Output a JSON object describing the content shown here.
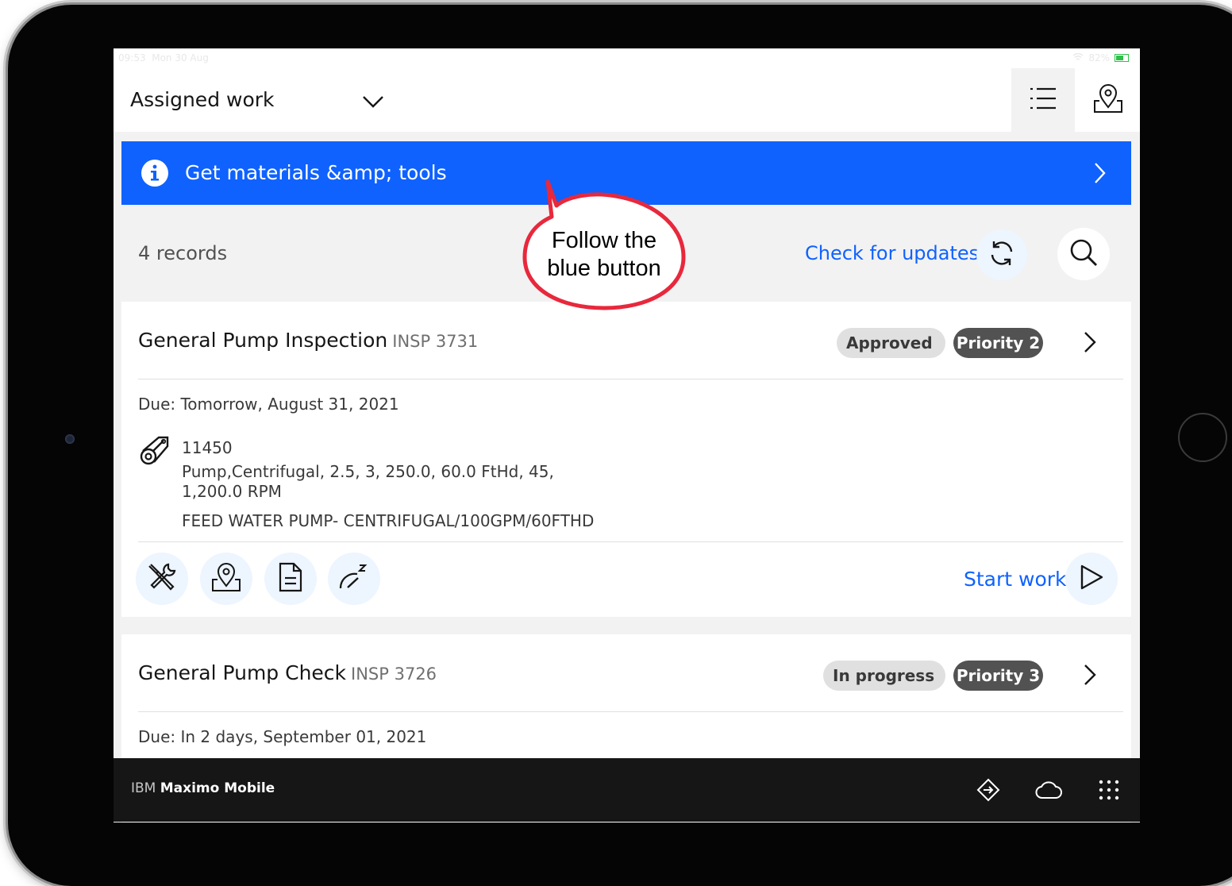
{
  "status_bar": {
    "time": "09:53",
    "date": "Mon 30 Aug",
    "battery": "82%"
  },
  "header": {
    "title": "Assigned work"
  },
  "banner": {
    "label": "Get materials &amp; tools"
  },
  "toolbar": {
    "records": "4 records",
    "check_updates": "Check for updates"
  },
  "work_orders": [
    {
      "title": "General Pump Inspection",
      "code": "INSP 3731",
      "status": "Approved",
      "priority": "Priority 2",
      "due": "Due: Tomorrow, August 31, 2021",
      "asset_number": "11450",
      "asset_description": "Pump,Centrifugal, 2.5, 3, 250.0, 60.0 FtHd, 45, 1,200.0 RPM",
      "asset_location": "FEED WATER PUMP- CENTRIFUGAL/100GPM/60FTHD",
      "start_label": "Start work"
    },
    {
      "title": "General Pump Check",
      "code": "INSP 3726",
      "status": "In progress",
      "priority": "Priority 3",
      "due": "Due: In 2 days, September 01, 2021"
    }
  ],
  "footer": {
    "brand_prefix": "IBM",
    "brand_name": "Maximo Mobile"
  },
  "annotation": {
    "line1": "Follow the",
    "line2": "blue button"
  },
  "colors": {
    "primary": "#0f62fe",
    "callout": "#e8283c",
    "footer": "#161616"
  },
  "icons": [
    "chevron-down-icon",
    "list-icon",
    "map-pin-icon",
    "info-icon",
    "chevron-right-icon",
    "refresh-icon",
    "search-icon",
    "asset-icon",
    "tools-icon",
    "document-icon",
    "meter-icon",
    "play-icon",
    "navigate-icon",
    "cloud-icon",
    "app-grid-icon"
  ]
}
